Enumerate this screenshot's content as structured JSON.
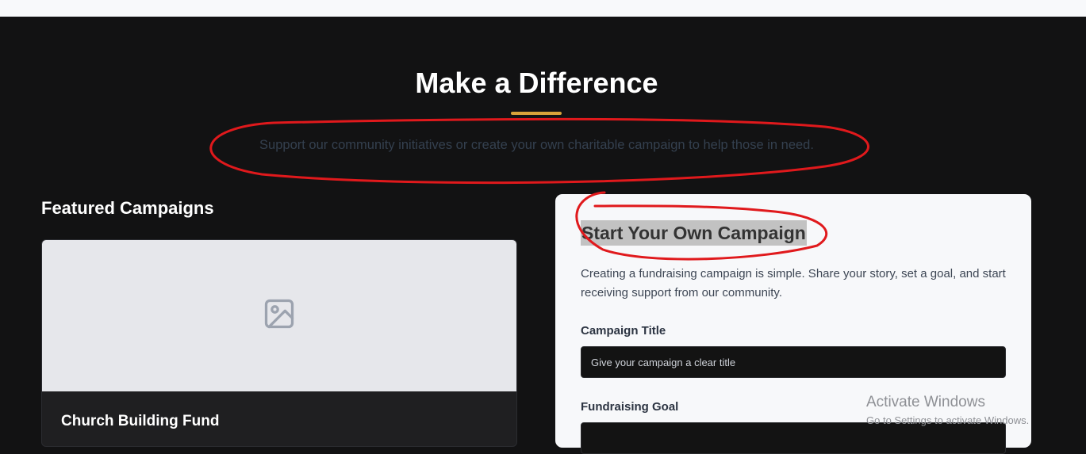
{
  "hero": {
    "title": "Make a Difference",
    "subtitle": "Support our community initiatives or create your own charitable campaign to help those in need."
  },
  "featured": {
    "section_title": "Featured Campaigns",
    "cards": [
      {
        "title": "Church Building Fund",
        "image_icon": "image-icon"
      }
    ]
  },
  "form": {
    "title": "Start Your Own Campaign",
    "description": "Creating a fundraising campaign is simple. Share your story, set a goal, and start receiving support from our community.",
    "fields": [
      {
        "label": "Campaign Title",
        "placeholder": "Give your campaign a clear title"
      },
      {
        "label": "Fundraising Goal",
        "placeholder": ""
      }
    ]
  },
  "os_watermark": {
    "title": "Activate Windows",
    "subtitle": "Go to Settings to activate Windows."
  },
  "colors": {
    "background": "#121213",
    "accent": "#d9a33a",
    "annotation": "#e0191c",
    "panel": "#f7f8fa"
  }
}
